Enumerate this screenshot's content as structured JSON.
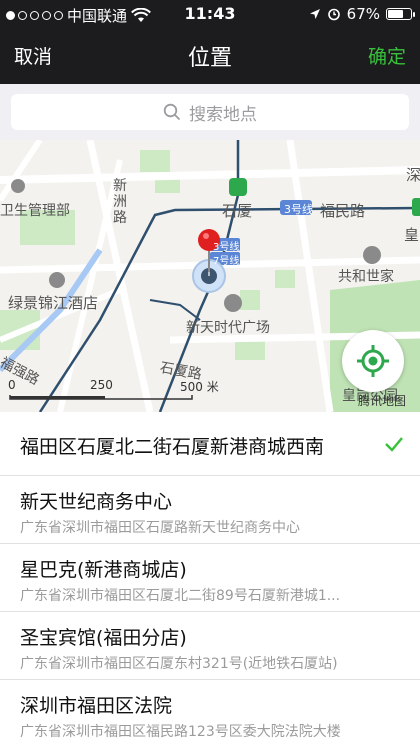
{
  "status_bar": {
    "carrier": "中国联通",
    "time": "11:43",
    "battery": "67%",
    "battery_level": 0.67,
    "signal_dots_filled": 1,
    "signal_dots_total": 5
  },
  "nav": {
    "cancel": "取消",
    "title": "位置",
    "confirm": "确定",
    "confirm_color": "#38c13a"
  },
  "search": {
    "placeholder": "搜索地点"
  },
  "map": {
    "labels": {
      "xinzhou": "新洲路",
      "xinzhou_v1": "新",
      "xinzhou_v2": "洲",
      "xinzhou_v3": "路",
      "shixia": "石厦",
      "fumin": "福民路",
      "metro_line": "3号线",
      "metro_tag1": "3号线",
      "metro_tag2": "7号线",
      "huang": "皇",
      "shen": "深",
      "weisheng": "卫生管理部",
      "gongheshijia": "共和世家",
      "lvjing": "绿景锦江酒店",
      "xintiandi": "新天时代广场",
      "fuqiang": "福强路",
      "shixia_rd": "石厦路",
      "huanggang": "皇岗公园",
      "tencent": "腾讯地图"
    },
    "scale": {
      "zero": "0",
      "mid": "250",
      "end": "500 米"
    }
  },
  "list": {
    "items": [
      {
        "title": "福田区石厦北二街石厦新港商城西南",
        "subtitle": "",
        "selected": true
      },
      {
        "title": "新天世纪商务中心",
        "subtitle": "广东省深圳市福田区石厦路新天世纪商务中心",
        "selected": false
      },
      {
        "title": "星巴克(新港商城店)",
        "subtitle": "广东省深圳市福田区石厦北二街89号石厦新港城1...",
        "selected": false
      },
      {
        "title": "圣宝宾馆(福田分店)",
        "subtitle": "广东省深圳市福田区石厦东村321号(近地铁石厦站)",
        "selected": false
      },
      {
        "title": "深圳市福田区法院",
        "subtitle": "广东省深圳市福田区福民路123号区委大院法院大楼",
        "selected": false
      }
    ]
  },
  "colors": {
    "accent_green": "#38c13a",
    "pin_red": "#e02020",
    "metro_blue": "#3a70c8"
  },
  "icons": {
    "search": "search-icon",
    "check": "check-icon",
    "locate": "locate-icon"
  }
}
